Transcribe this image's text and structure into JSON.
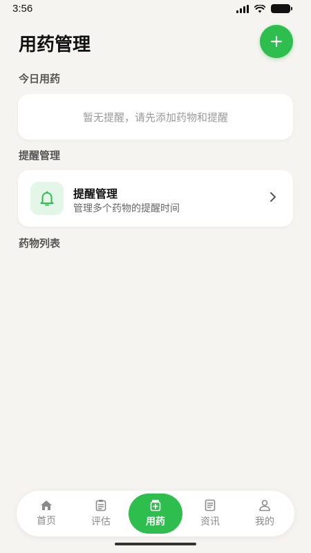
{
  "status_bar": {
    "time": "3:56"
  },
  "header": {
    "title": "用药管理",
    "add_icon": "plus-icon"
  },
  "today": {
    "label": "今日用药",
    "empty_text": "暂无提醒，请先添加药物和提醒"
  },
  "reminder_section": {
    "label": "提醒管理",
    "card": {
      "title": "提醒管理",
      "subtitle": "管理多个药物的提醒时间",
      "icon": "bell-icon"
    }
  },
  "medicine_list": {
    "label": "药物列表"
  },
  "bottom_nav": {
    "items": [
      {
        "label": "首页",
        "icon": "home-icon"
      },
      {
        "label": "评估",
        "icon": "clipboard-icon"
      },
      {
        "label": "用药",
        "icon": "medicine-icon",
        "active": true
      },
      {
        "label": "资讯",
        "icon": "news-icon"
      },
      {
        "label": "我的",
        "icon": "user-icon"
      }
    ]
  },
  "colors": {
    "accent": "#2DBE4E",
    "background": "#F5F4F0",
    "accent_light": "#E3F6E8"
  }
}
